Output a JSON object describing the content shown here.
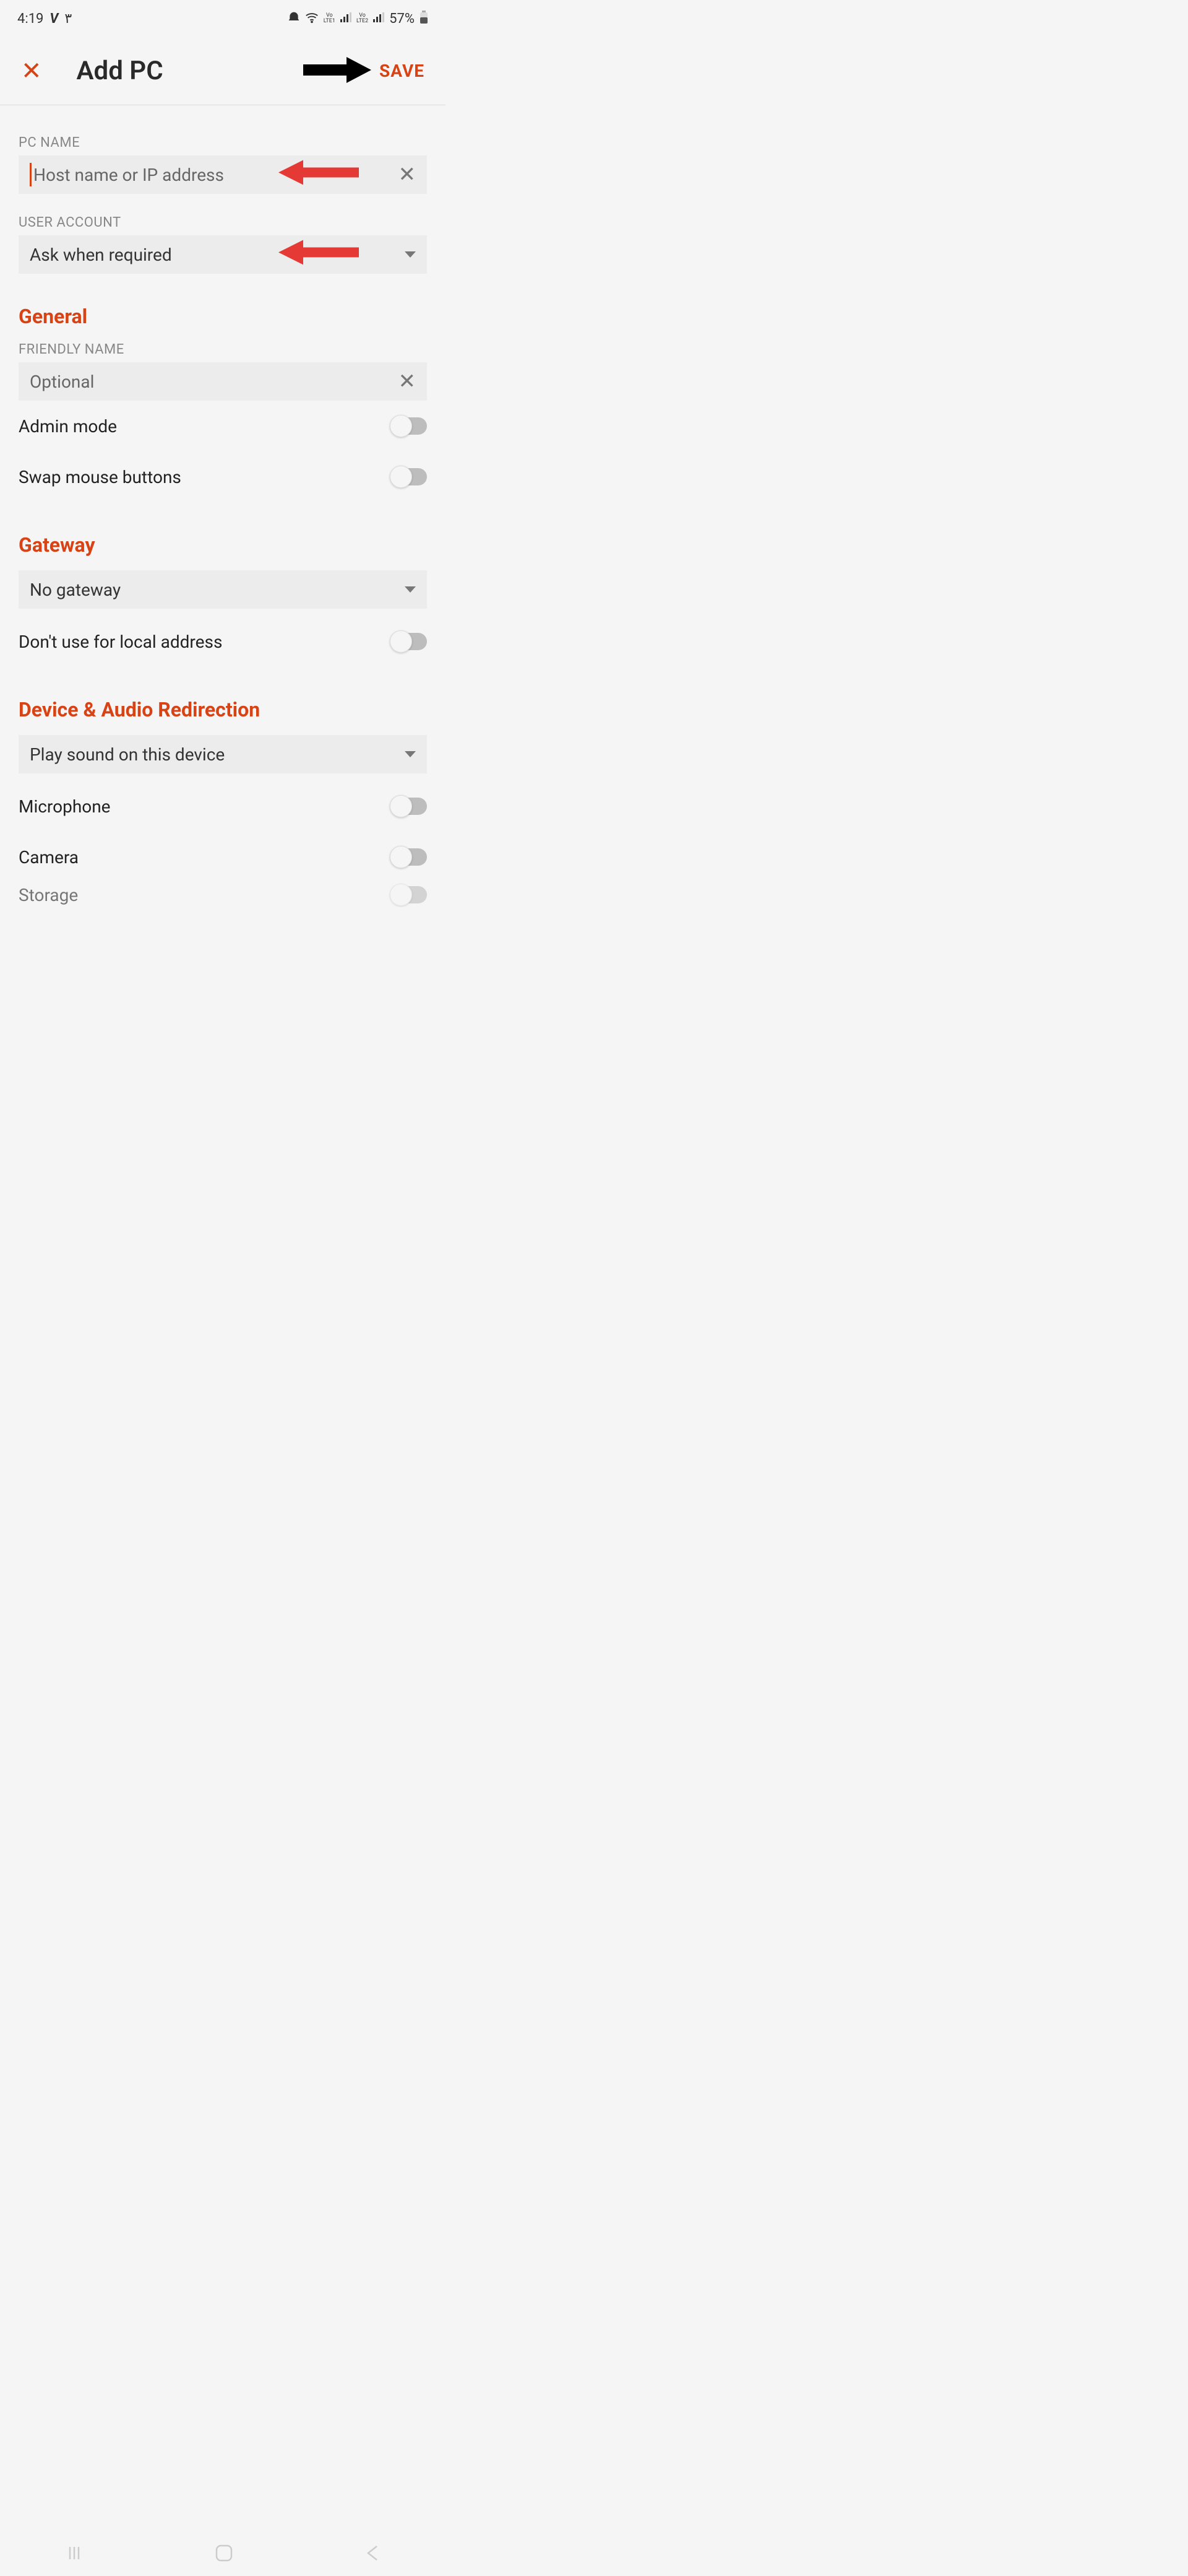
{
  "status": {
    "time": "4:19",
    "extra": "۳",
    "battery_pct": "57%",
    "lte1": "LTE1",
    "lte2": "LTE2",
    "vo": "Vo"
  },
  "header": {
    "title": "Add PC",
    "save": "SAVE"
  },
  "pc_name": {
    "label": "PC NAME",
    "placeholder": "Host name or IP address"
  },
  "user_account": {
    "label": "USER ACCOUNT",
    "value": "Ask when required"
  },
  "general": {
    "title": "General",
    "friendly_label": "FRIENDLY NAME",
    "friendly_placeholder": "Optional",
    "admin_mode": "Admin mode",
    "swap_mouse": "Swap mouse buttons"
  },
  "gateway": {
    "title": "Gateway",
    "value": "No gateway",
    "local_addr": "Don't use for local address"
  },
  "device_audio": {
    "title": "Device & Audio Redirection",
    "sound_value": "Play sound on this device",
    "microphone": "Microphone",
    "camera": "Camera",
    "storage": "Storage"
  }
}
